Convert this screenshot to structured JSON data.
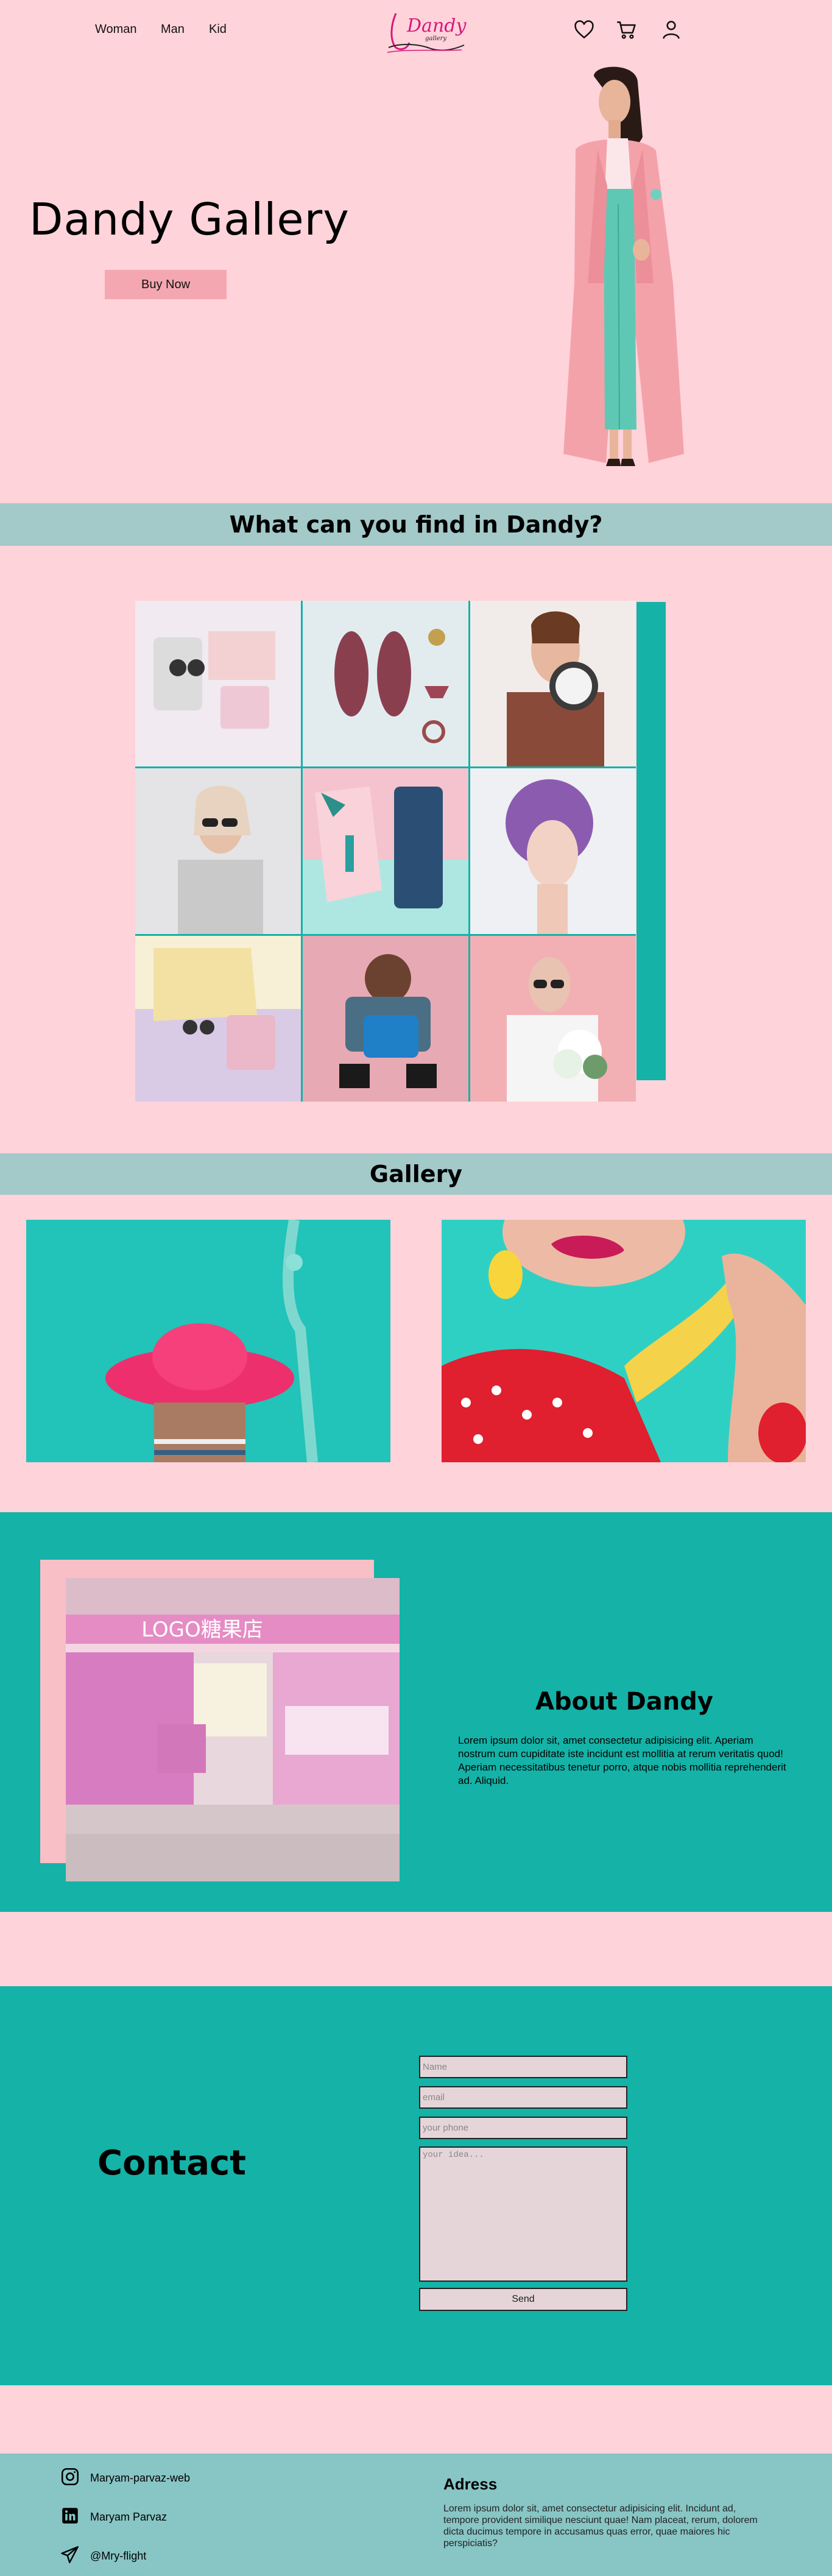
{
  "nav": {
    "links": [
      "Woman",
      "Man",
      "Kid"
    ],
    "logo_text": "Dandy",
    "logo_sub": "gallery",
    "icons": [
      "heart-icon",
      "cart-icon",
      "user-icon"
    ]
  },
  "hero": {
    "title": "Dandy Gallery",
    "button": "Buy Now"
  },
  "find": {
    "heading": "What can you find in Dandy?"
  },
  "gallery": {
    "heading": "Gallery"
  },
  "about": {
    "title": "About Dandy",
    "text": "Lorem ipsum dolor sit, amet consectetur adipisicing elit. Aperiam nostrum cum cupiditate iste incidunt est mollitia at rerum veritatis quod! Aperiam necessitatibus tenetur porro, atque nobis mollitia reprehenderit ad. Aliquid.",
    "store_sign": "LOGO糖果店"
  },
  "contact": {
    "title": "Contact",
    "name_placeholder": "Name",
    "email_placeholder": "email",
    "phone_placeholder": "your phone",
    "ideas_placeholder": "your idea...",
    "send": "Send"
  },
  "footer": {
    "instagram": "Maryam-parvaz-web",
    "linkedin": "Maryam Parvaz",
    "telegram": "@Mry-flight",
    "address_title": "Adress",
    "address_text": "Lorem ipsum dolor sit, amet consectetur adipisicing elit. Incidunt ad, tempore provident similique nesciunt quae! Nam placeat, rerum, dolorem dicta ducimus tempore in accusamus quas error, quae maiores hic perspiciatis?"
  },
  "colors": {
    "page_bg": "#ffd3da",
    "band_bg": "#a3c9c9",
    "teal": "#14b2a7",
    "button_pink": "#f4a7b0",
    "footer_bg": "#88c5c5"
  }
}
